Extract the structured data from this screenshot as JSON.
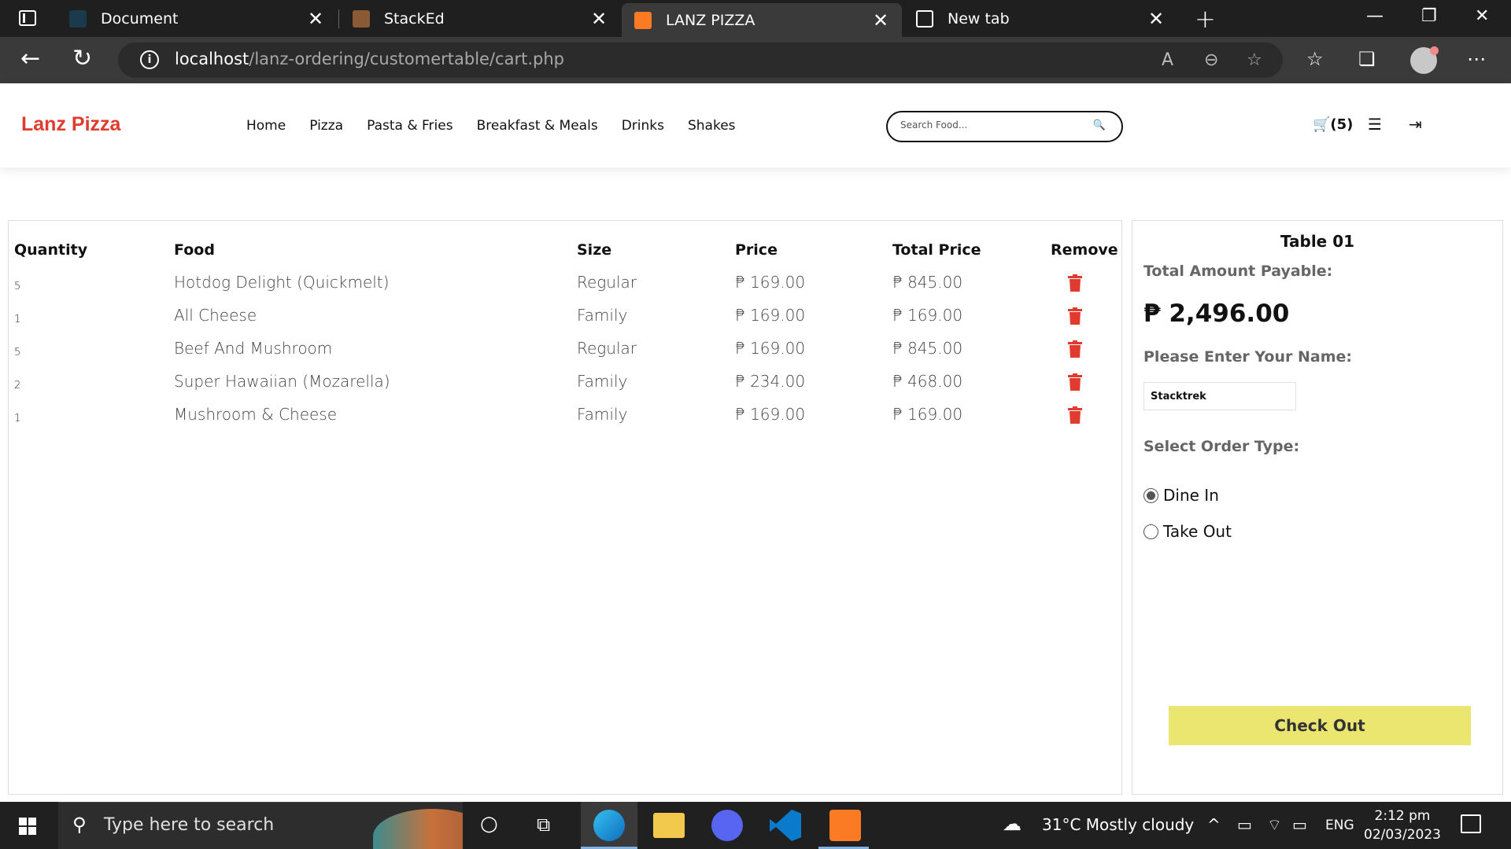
{
  "browser": {
    "tabs": [
      {
        "label": "Document",
        "favicon_color": "#1b3a4b"
      },
      {
        "label": "StackEd",
        "favicon_color": "#8a5a35"
      },
      {
        "label": "LANZ PIZZA",
        "favicon_color": "#fb7a24"
      },
      {
        "label": "New tab",
        "favicon_color": "#ffffff"
      }
    ],
    "url_host": "localhost",
    "url_path": "/lanz-ordering/customertable/cart.php"
  },
  "site": {
    "logo": "Lanz Pizza",
    "brand_color": "#e13a2f",
    "nav": [
      "Home",
      "Pizza",
      "Pasta & Fries",
      "Breakfast & Meals",
      "Drinks",
      "Shakes"
    ],
    "search_placeholder": "Search Food...",
    "cart_count": "(5)"
  },
  "cart": {
    "headers": [
      "Quantity",
      "Food",
      "Size",
      "Price",
      "Total Price",
      "Remove"
    ],
    "rows": [
      {
        "qty": "5",
        "food": "Hotdog Delight (Quickmelt)",
        "size": "Regular",
        "price": "₱ 169.00",
        "total": "₱ 845.00"
      },
      {
        "qty": "1",
        "food": "All Cheese",
        "size": "Family",
        "price": "₱ 169.00",
        "total": "₱ 169.00"
      },
      {
        "qty": "5",
        "food": "Beef And Mushroom",
        "size": "Regular",
        "price": "₱ 169.00",
        "total": "₱ 845.00"
      },
      {
        "qty": "2",
        "food": "Super Hawaiian (Mozarella)",
        "size": "Family",
        "price": "₱ 234.00",
        "total": "₱ 468.00"
      },
      {
        "qty": "1",
        "food": "Mushroom & Cheese",
        "size": "Family",
        "price": "₱ 169.00",
        "total": "₱ 169.00"
      }
    ],
    "remove_icon": "trash-icon"
  },
  "order": {
    "table": "Table 01",
    "total_label": "Total Amount Payable:",
    "total_amount": "₱ 2,496.00",
    "name_label": "Please Enter Your Name:",
    "name_value": "Stacktrek",
    "type_label": "Select Order Type:",
    "options": [
      {
        "label": "Dine In",
        "checked": true
      },
      {
        "label": "Take Out",
        "checked": false
      }
    ],
    "checkout_label": "Check Out",
    "checkout_color": "#ebe66f"
  },
  "taskbar": {
    "search_placeholder": "Type here to search",
    "weather": "31°C  Mostly cloudy",
    "language": "ENG",
    "time": "2:12 pm",
    "date": "02/03/2023"
  }
}
